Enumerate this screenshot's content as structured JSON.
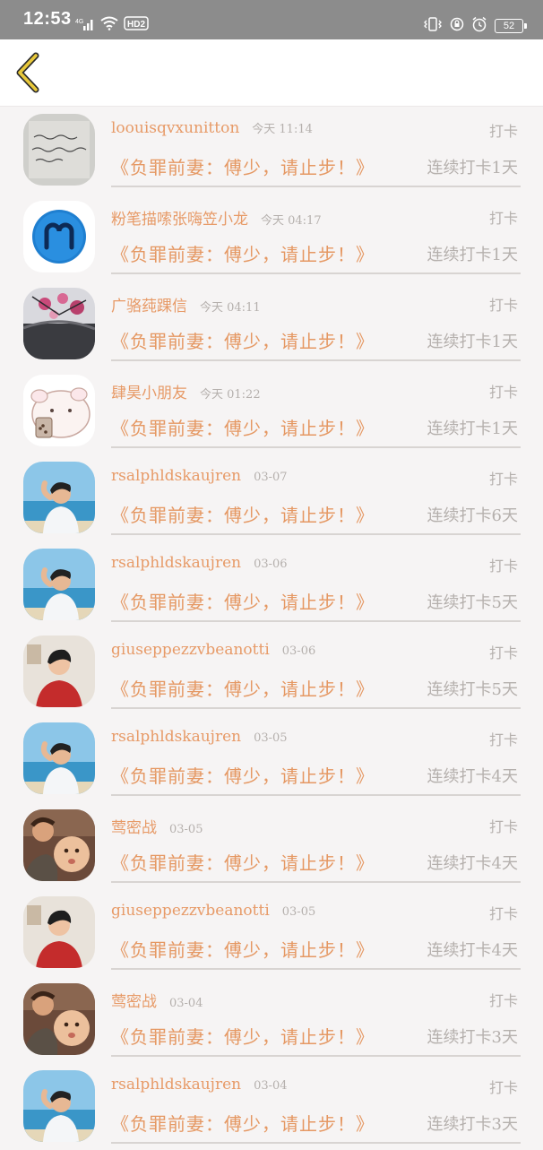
{
  "status_bar": {
    "time": "12:53",
    "battery": "52",
    "network": "4G",
    "hd": "HD2"
  },
  "header": {
    "back_icon": "chevron-left-icon"
  },
  "rows": [
    {
      "name": "loouisqvxunitton",
      "time": "今天 11:14",
      "checkin": "打卡",
      "title": "《负罪前妻：傅少，请止步！》",
      "streak": "连续打卡1天",
      "avatar": "handwriting-note"
    },
    {
      "name": "粉笔描嗦张嗨笠小龙",
      "time": "今天 04:17",
      "checkin": "打卡",
      "title": "《负罪前妻：傅少，请止步！》",
      "streak": "连续打卡1天",
      "avatar": "aries-blue-circle"
    },
    {
      "name": "广骆莼踝信",
      "time": "今天 04:11",
      "checkin": "打卡",
      "title": "《负罪前妻：傅少，请止步！》",
      "streak": "连续打卡1天",
      "avatar": "plum-blossom"
    },
    {
      "name": "肆昊小朋友",
      "time": "今天 01:22",
      "checkin": "打卡",
      "title": "《负罪前妻：傅少，请止步！》",
      "streak": "连续打卡1天",
      "avatar": "cartoon-bear"
    },
    {
      "name": "rsalphldskaujren",
      "time": "03-07",
      "checkin": "打卡",
      "title": "《负罪前妻：傅少，请止步！》",
      "streak": "连续打卡6天",
      "avatar": "beach-boy"
    },
    {
      "name": "rsalphldskaujren",
      "time": "03-06",
      "checkin": "打卡",
      "title": "《负罪前妻：傅少，请止步！》",
      "streak": "连续打卡5天",
      "avatar": "beach-boy"
    },
    {
      "name": "giuseppezzvbeanotti",
      "time": "03-06",
      "checkin": "打卡",
      "title": "《负罪前妻：傅少，请止步！》",
      "streak": "连续打卡5天",
      "avatar": "red-shirt-boy"
    },
    {
      "name": "rsalphldskaujren",
      "time": "03-05",
      "checkin": "打卡",
      "title": "《负罪前妻：傅少，请止步！》",
      "streak": "连续打卡4天",
      "avatar": "beach-boy"
    },
    {
      "name": "莺密战",
      "time": "03-05",
      "checkin": "打卡",
      "title": "《负罪前妻：傅少，请止步！》",
      "streak": "连续打卡4天",
      "avatar": "baby-selfie"
    },
    {
      "name": "giuseppezzvbeanotti",
      "time": "03-05",
      "checkin": "打卡",
      "title": "《负罪前妻：傅少，请止步！》",
      "streak": "连续打卡4天",
      "avatar": "red-shirt-boy"
    },
    {
      "name": "莺密战",
      "time": "03-04",
      "checkin": "打卡",
      "title": "《负罪前妻：傅少，请止步！》",
      "streak": "连续打卡3天",
      "avatar": "baby-selfie"
    },
    {
      "name": "rsalphldskaujren",
      "time": "03-04",
      "checkin": "打卡",
      "title": "《负罪前妻：傅少，请止步！》",
      "streak": "连续打卡3天",
      "avatar": "beach-boy"
    }
  ],
  "colors": {
    "accent": "#e59863",
    "muted": "#b5b0ad",
    "background": "#f6f4f4",
    "status_bar": "#8c8c8c",
    "back_icon": "#e8c83a"
  }
}
